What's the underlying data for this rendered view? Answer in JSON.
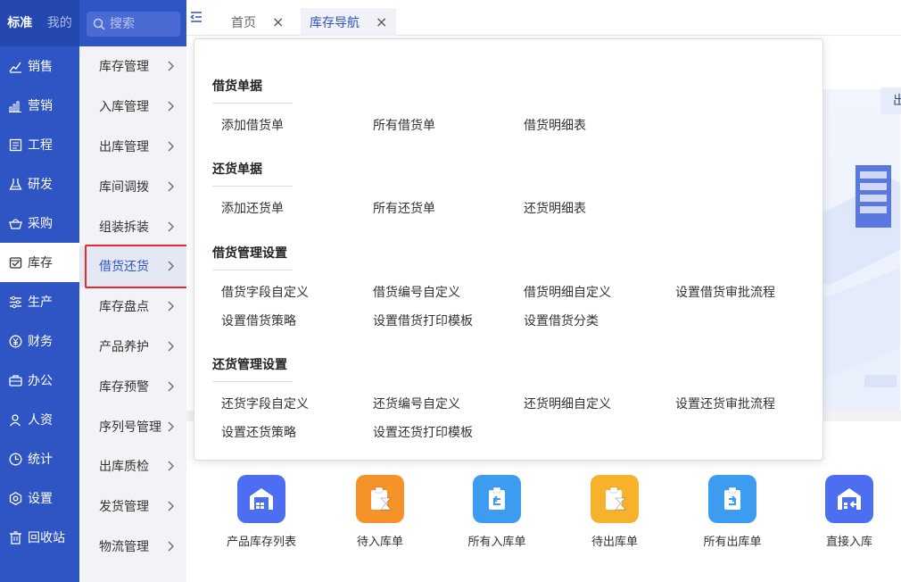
{
  "mode_tabs": [
    "标准",
    "我的"
  ],
  "search": {
    "placeholder": "搜索"
  },
  "main_nav": [
    {
      "label": "销售",
      "icon": "bar-chart-icon"
    },
    {
      "label": "营销",
      "icon": "signal-icon"
    },
    {
      "label": "工程",
      "icon": "document-icon"
    },
    {
      "label": "研发",
      "icon": "flask-icon"
    },
    {
      "label": "采购",
      "icon": "basket-icon"
    },
    {
      "label": "库存",
      "icon": "inventory-icon",
      "active": true
    },
    {
      "label": "生产",
      "icon": "production-icon"
    },
    {
      "label": "财务",
      "icon": "yen-icon"
    },
    {
      "label": "办公",
      "icon": "briefcase-icon"
    },
    {
      "label": "人资",
      "icon": "user-icon"
    },
    {
      "label": "统计",
      "icon": "clock-icon"
    },
    {
      "label": "设置",
      "icon": "hexagon-gear-icon"
    },
    {
      "label": "回收站",
      "icon": "trash-icon"
    }
  ],
  "sub_nav": [
    {
      "label": "库存管理"
    },
    {
      "label": "入库管理"
    },
    {
      "label": "出库管理"
    },
    {
      "label": "库间调拨"
    },
    {
      "label": "组装拆装"
    },
    {
      "label": "借货还货",
      "active": true
    },
    {
      "label": "库存盘点"
    },
    {
      "label": "产品养护"
    },
    {
      "label": "库存预警"
    },
    {
      "label": "序列号管理"
    },
    {
      "label": "出库质检"
    },
    {
      "label": "发货管理"
    },
    {
      "label": "物流管理"
    }
  ],
  "tabs": [
    {
      "label": "首页",
      "close": "×"
    },
    {
      "label": "库存导航",
      "close": "×"
    }
  ],
  "popup": {
    "sections": [
      {
        "title": "借货单据",
        "links": [
          "添加借货单",
          "所有借货单",
          "借货明细表"
        ]
      },
      {
        "title": "还货单据",
        "links": [
          "添加还货单",
          "所有还货单",
          "还货明细表"
        ]
      },
      {
        "title": "借货管理设置",
        "links": [
          "借货字段自定义",
          "借货编号自定义",
          "借货明细自定义",
          "设置借货审批流程",
          "设置借货策略",
          "设置借货打印模板",
          "设置借货分类"
        ]
      },
      {
        "title": "还货管理设置",
        "links": [
          "还货字段自定义",
          "还货编号自定义",
          "还货明细自定义",
          "设置还货审批流程",
          "设置还货策略",
          "设置还货打印模板"
        ]
      }
    ]
  },
  "background_label": "出",
  "quick_actions": [
    {
      "label": "产品库存列表",
      "color": "#4e6ef2",
      "icon": "warehouse-icon"
    },
    {
      "label": "待入库单",
      "color": "#f5932a",
      "icon": "clipboard-hourglass-icon"
    },
    {
      "label": "所有入库单",
      "color": "#3d9bf0",
      "icon": "clipboard-in-icon"
    },
    {
      "label": "待出库单",
      "color": "#f6b12d",
      "icon": "clipboard-hourglass-icon"
    },
    {
      "label": "所有出库单",
      "color": "#3d9bf0",
      "icon": "clipboard-out-icon"
    },
    {
      "label": "直接入库",
      "color": "#4e6ef2",
      "icon": "warehouse-in-icon"
    }
  ],
  "colors": {
    "sidebar": "#2f54c4",
    "accent": "#2f54c4",
    "highlight_border": "#e8282d"
  }
}
